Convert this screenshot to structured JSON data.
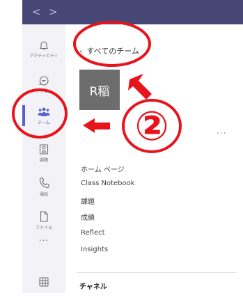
{
  "titlebar": {
    "back": "<",
    "forward": ">"
  },
  "rail": {
    "items": [
      {
        "label": "アクティビティ",
        "icon": "bell-icon"
      },
      {
        "label": "チャット",
        "icon": "chat-icon"
      },
      {
        "label": "チーム",
        "icon": "teams-icon",
        "active": true
      },
      {
        "label": "課題",
        "icon": "assignments-icon"
      },
      {
        "label": "通話",
        "icon": "phone-icon"
      },
      {
        "label": "ファイル",
        "icon": "file-icon"
      },
      {
        "label": "...",
        "icon": "more-icon"
      },
      {
        "label": "",
        "icon": "apps-icon"
      }
    ]
  },
  "panel": {
    "back_label": "すべてのチーム",
    "team_avatar": "R稲",
    "more": "...",
    "menu": [
      "ホーム ページ",
      "Class Notebook",
      "課題",
      "成績",
      "Reflect",
      "Insights"
    ],
    "section": "チャネル"
  },
  "annotation": {
    "number": "②"
  },
  "colors": {
    "titlebar": "#464775",
    "accent": "#5b5fc7",
    "annotation": "#e8141c"
  }
}
